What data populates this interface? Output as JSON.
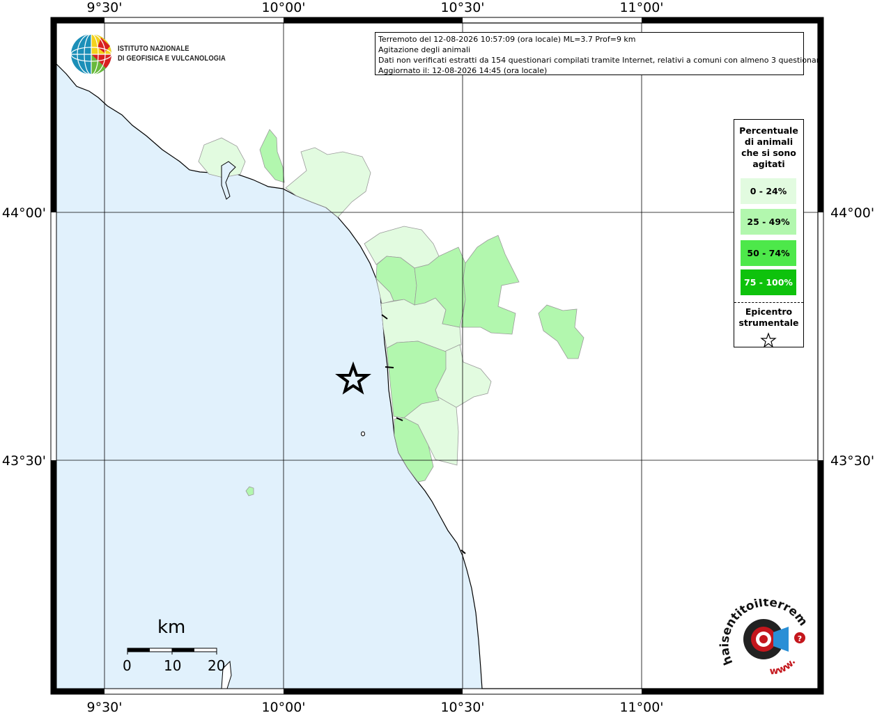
{
  "info": {
    "line1": "Terremoto del 12-08-2026 10:57:09 (ora locale) ML=3.7 Prof=9 km",
    "line2": "Agitazione degli animali",
    "line3": "Dati non verificati estratti da 154 questionari compilati tramite Internet, relativi a comuni con almeno 3 questionari.",
    "line4": "Aggiornato il: 12-08-2026 14:45 (ora locale)"
  },
  "axis": {
    "lon_ticks": [
      "9°30'",
      "10°00'",
      "10°30'",
      "11°00'"
    ],
    "lat_ticks": [
      "44°00'",
      "43°30'"
    ]
  },
  "legend": {
    "title": "Percentuale di animali che si sono agitati",
    "classes": [
      {
        "label": "0 - 24%",
        "color": "#e2fbe0"
      },
      {
        "label": "25 - 49%",
        "color": "#b2f7ae"
      },
      {
        "label": "50 - 74%",
        "color": "#4de84a"
      },
      {
        "label": "75 - 100%",
        "color": "#0ec20c"
      }
    ],
    "epicenter_label": "Epicentro strumentale"
  },
  "scale_bar": {
    "unit": "km",
    "ticks": [
      "0",
      "10",
      "20"
    ]
  },
  "logos": {
    "ingv_line1": "ISTITUTO NAZIONALE",
    "ingv_line2": "DI GEOFISICA E VULCANOLOGIA",
    "hsit_text": "haisentitoilterremoto.it",
    "hsit_www": "www."
  },
  "colors": {
    "sea": "#e1f1fc",
    "land": "#ffffff",
    "coast": "#000000"
  }
}
